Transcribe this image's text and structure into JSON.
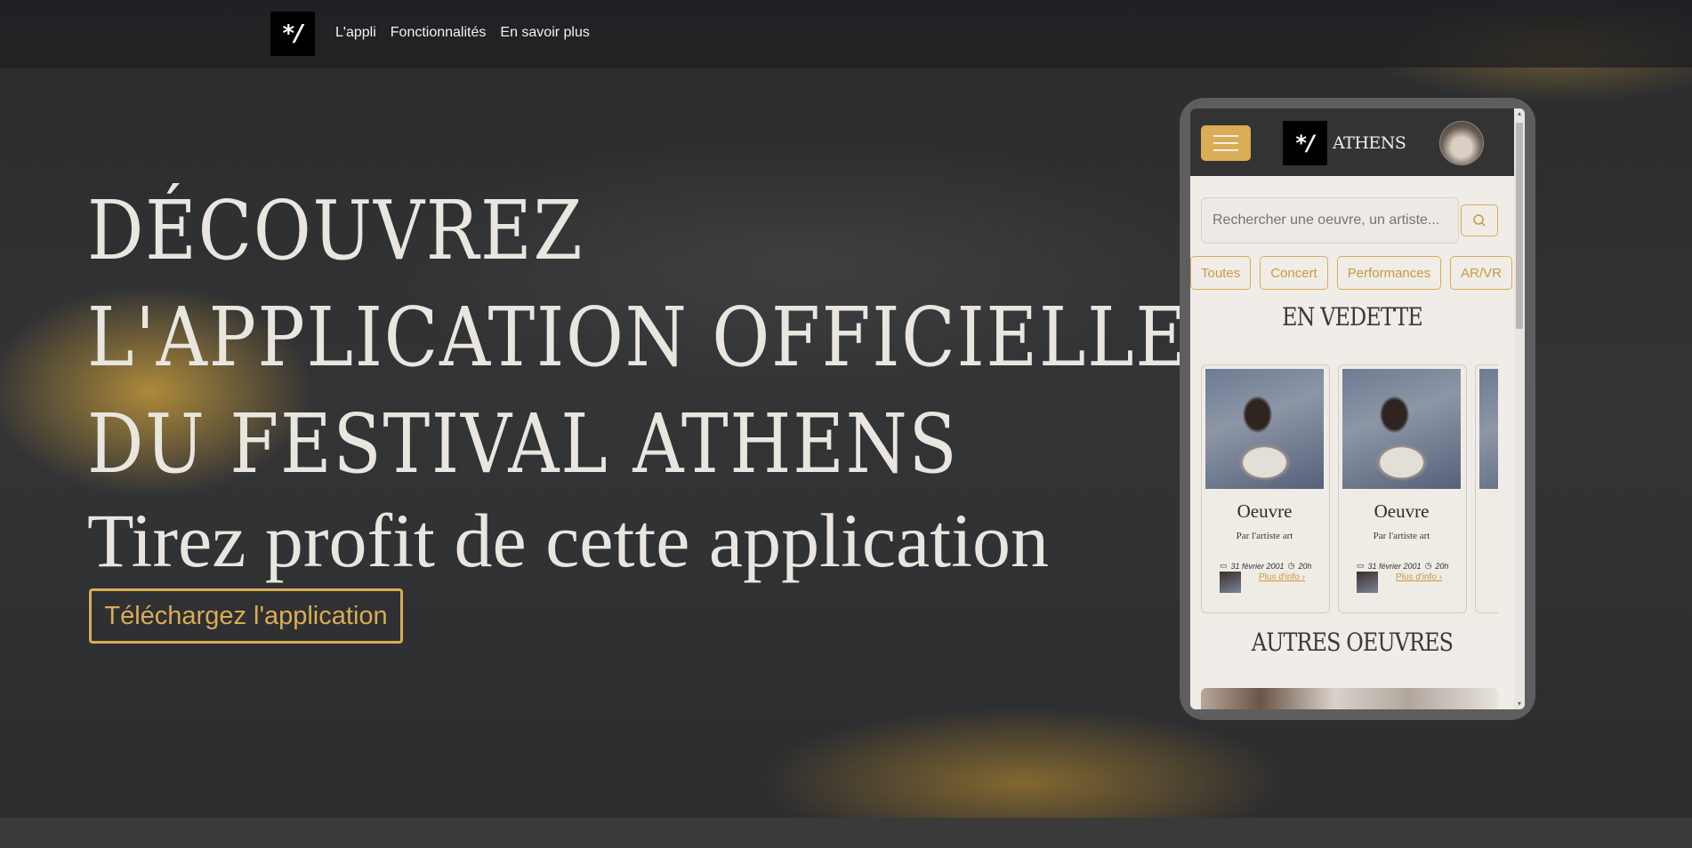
{
  "navbar": {
    "logo_text": "*/",
    "links": [
      "L'appli",
      "Fonctionnalités",
      "En savoir plus"
    ]
  },
  "hero": {
    "headline_lines": [
      "DÉCOUVREZ",
      "L'APPLICATION OFFICIELLE",
      "DU FESTIVAL ATHENS"
    ],
    "subline": "Tirez profit de cette application",
    "download_label": "Téléchargez l'application"
  },
  "phone": {
    "app_logo_text": "*/",
    "app_name": "ATHENS",
    "search_placeholder": "Rechercher une oeuvre, un artiste...",
    "chips": [
      "Toutes",
      "Concert",
      "Performances",
      "AR/VR"
    ],
    "featured_title": "EN VEDETTE",
    "other_title": "AUTRES OEUVRES",
    "cards": [
      {
        "title": "Oeuvre",
        "artist": "Par l'artiste art",
        "date": "31 février 2001",
        "time": "20h",
        "more": "Plus d'info"
      },
      {
        "title": "Oeuvre",
        "artist": "Par l'artiste art",
        "date": "31 février 2001",
        "time": "20h",
        "more": "Plus d'info"
      }
    ]
  },
  "colors": {
    "accent": "#d8ad55",
    "headline": "#e9e5df",
    "background": "#2e2f31",
    "app_surface": "#f0ece7"
  },
  "icons": {
    "search": "search-icon",
    "menu": "hamburger-icon",
    "calendar": "calendar-icon",
    "clock": "clock-icon",
    "chevron": "chevron-right-icon"
  }
}
